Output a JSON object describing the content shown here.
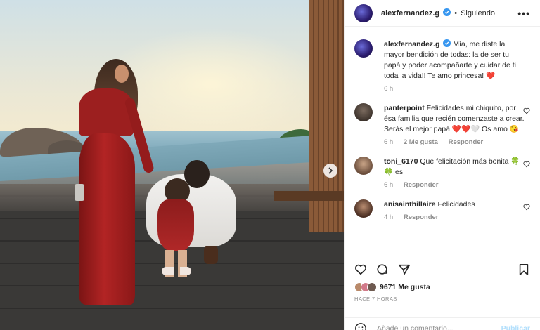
{
  "colors": {
    "accent_blue": "#0095f6",
    "verified_blue": "#3897f0",
    "muted": "#8e8e8e",
    "heart_red": "#e0245e"
  },
  "post": {
    "author": "alexfernandez.g",
    "follow_state": "Siguiendo",
    "more_icon": "more-horizontal-icon",
    "next_icon": "chevron-right-icon"
  },
  "caption": {
    "user": "alexfernandez.g",
    "text": "Mía, me diste la mayor bendición de todas: la de ser tu papá y poder acompañarte y cuidar de ti toda la vida!! Te amo princesa! ",
    "emoji": "❤️",
    "time": "6 h"
  },
  "comments": [
    {
      "user": "panterpoint",
      "text": "Felicidades mi chiquito, por ésa familia que recién comenzaste a crear. Serás el mejor papá ",
      "emoji": "❤️❤️🤍",
      "text2": " Os amo ",
      "emoji2": "😘",
      "time": "6 h",
      "likes": "2 Me gusta",
      "reply": "Responder"
    },
    {
      "user": "toni_6170",
      "text": "Que felicitación más bonita ",
      "emoji": "🍀🍀",
      "text2": "es",
      "time": "6 h",
      "reply": "Responder"
    },
    {
      "user": "anisainthillaire",
      "text": "Felicidades",
      "time": "4 h",
      "reply": "Responder"
    }
  ],
  "footer": {
    "likes": "9671 Me gusta",
    "ago": "HACE 7 HORAS",
    "add_placeholder": "Añade un comentario...",
    "publish": "Publicar"
  },
  "icons": [
    "heart-icon",
    "comment-icon",
    "share-icon",
    "bookmark-icon",
    "emoji-icon"
  ]
}
